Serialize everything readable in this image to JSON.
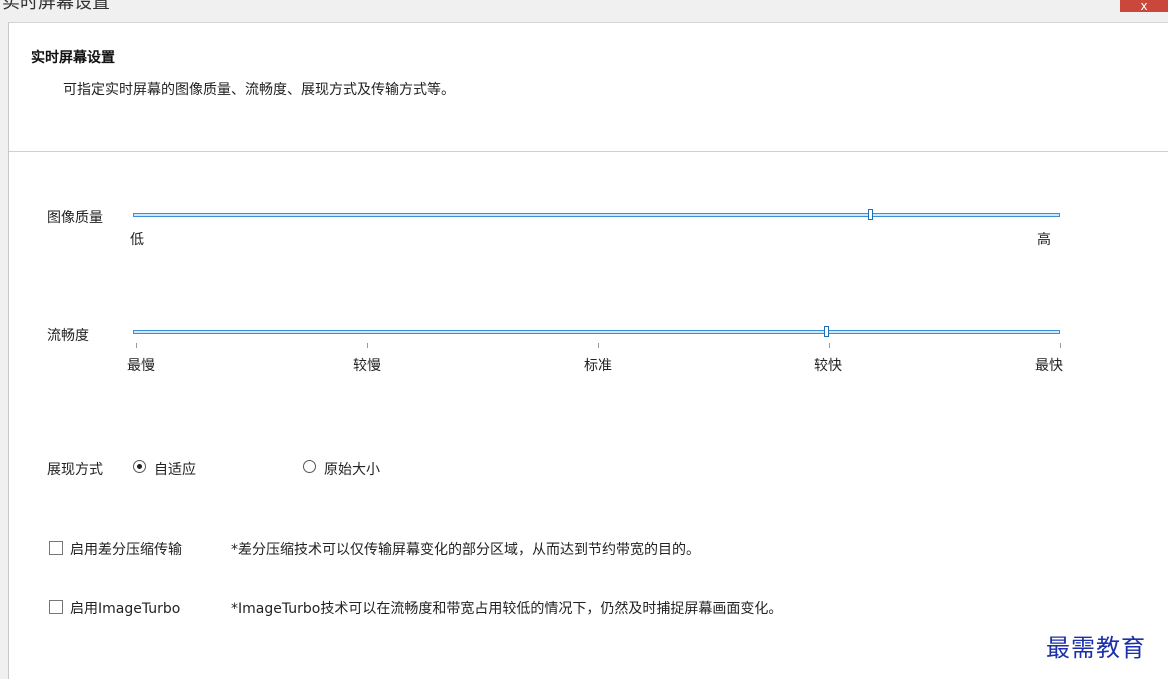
{
  "window": {
    "title": "实时屏幕设置",
    "close_label": "x"
  },
  "header": {
    "title": "实时屏幕设置",
    "description": "可指定实时屏幕的图像质量、流畅度、展现方式及传输方式等。"
  },
  "image_quality": {
    "label": "图像质量",
    "min_label": "低",
    "max_label": "高",
    "value_fraction": 0.795
  },
  "smoothness": {
    "label": "流畅度",
    "ticks": [
      "最慢",
      "较慢",
      "标准",
      "较快",
      "最快"
    ],
    "value_fraction": 0.748
  },
  "display_mode": {
    "label": "展现方式",
    "options": [
      {
        "label": "自适应",
        "selected": true
      },
      {
        "label": "原始大小",
        "selected": false
      }
    ]
  },
  "diff_compression": {
    "label": "启用差分压缩传输",
    "checked": false,
    "note": "*差分压缩技术可以仅传输屏幕变化的部分区域，从而达到节约带宽的目的。"
  },
  "image_turbo": {
    "label": "启用ImageTurbo",
    "checked": false,
    "note": "*ImageTurbo技术可以在流畅度和带宽占用较低的情况下，仍然及时捕捉屏幕画面变化。"
  },
  "watermark": "最需教育",
  "colors": {
    "accent": "#3b8fd6",
    "close_button": "#c9483b"
  }
}
